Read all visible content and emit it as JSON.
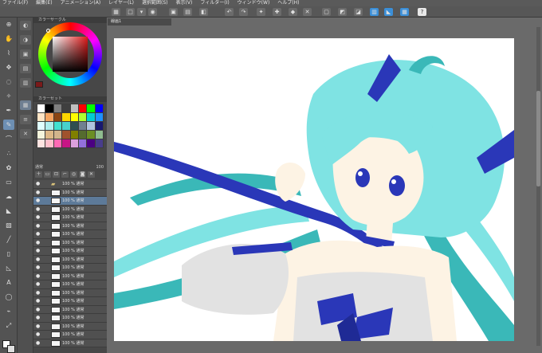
{
  "menu": {
    "items": [
      "ファイル(F)",
      "編集(E)",
      "アニメーション(A)",
      "レイヤー(L)",
      "選択範囲(S)",
      "表示(V)",
      "フィルター(I)",
      "ウィンドウ(W)",
      "ヘルプ(H)"
    ]
  },
  "panels": {
    "color_wheel_title": "カラーサークル",
    "palette_title": "カラーセット"
  },
  "layers": {
    "blend_mode": "通常",
    "opacity": "100",
    "rows": [
      {
        "name": "100 % 通常",
        "type": "folder",
        "selected": false
      },
      {
        "name": "100 % 通常",
        "type": "layer",
        "selected": false
      },
      {
        "name": "100 % 通常",
        "type": "layer",
        "selected": true
      },
      {
        "name": "100 % 通常",
        "type": "layer",
        "selected": false
      },
      {
        "name": "100 % 通常",
        "type": "layer",
        "selected": false
      },
      {
        "name": "100 % 通常",
        "type": "layer",
        "selected": false
      },
      {
        "name": "100 % 通常",
        "type": "layer",
        "selected": false
      },
      {
        "name": "100 % 通常",
        "type": "layer",
        "selected": false
      },
      {
        "name": "100 % 通常",
        "type": "layer",
        "selected": false
      },
      {
        "name": "100 % 通常",
        "type": "layer",
        "selected": false
      },
      {
        "name": "100 % 通常",
        "type": "layer",
        "selected": false
      },
      {
        "name": "100 % 通常",
        "type": "layer",
        "selected": false
      },
      {
        "name": "100 % 通常",
        "type": "layer",
        "selected": false
      },
      {
        "name": "100 % 通常",
        "type": "layer",
        "selected": false
      },
      {
        "name": "100 % 通常",
        "type": "layer",
        "selected": false
      },
      {
        "name": "100 % 通常",
        "type": "layer",
        "selected": false
      },
      {
        "name": "100 % 通常",
        "type": "layer",
        "selected": false
      },
      {
        "name": "100 % 通常",
        "type": "layer",
        "selected": false
      },
      {
        "name": "100 % 通常",
        "type": "layer",
        "selected": false
      },
      {
        "name": "100 % 通常",
        "type": "layer",
        "selected": false
      }
    ]
  },
  "canvas": {
    "tab_title": "線画1"
  },
  "colors": {
    "accent": "#3b8fd8",
    "hair": "#7fe3e3",
    "hair_dark": "#3ab8b8",
    "ribbon": "#2a37b8",
    "skin": "#fdf3e4",
    "dress": "#e2e2e2"
  },
  "palette": [
    "#ffffff",
    "#000000",
    "#7f7f7f",
    "#3f3f3f",
    "#bfbfbf",
    "#ff0000",
    "#00ff00",
    "#0000ff",
    "#ffe4c4",
    "#f4a460",
    "#8b4513",
    "#ffd700",
    "#ffff00",
    "#adff2f",
    "#00ced1",
    "#1e90ff",
    "#e0ffff",
    "#afeeee",
    "#40e0d0",
    "#48d1cc",
    "#2f4f4f",
    "#708090",
    "#b0c4de",
    "#191970",
    "#f5f5dc",
    "#deb887",
    "#d2b48c",
    "#a0522d",
    "#808000",
    "#556b2f",
    "#6b8e23",
    "#8fbc8f",
    "#ffe4e1",
    "#ffc0cb",
    "#ff69b4",
    "#c71585",
    "#dda0dd",
    "#9370db",
    "#4b0082",
    "#483d8b"
  ]
}
